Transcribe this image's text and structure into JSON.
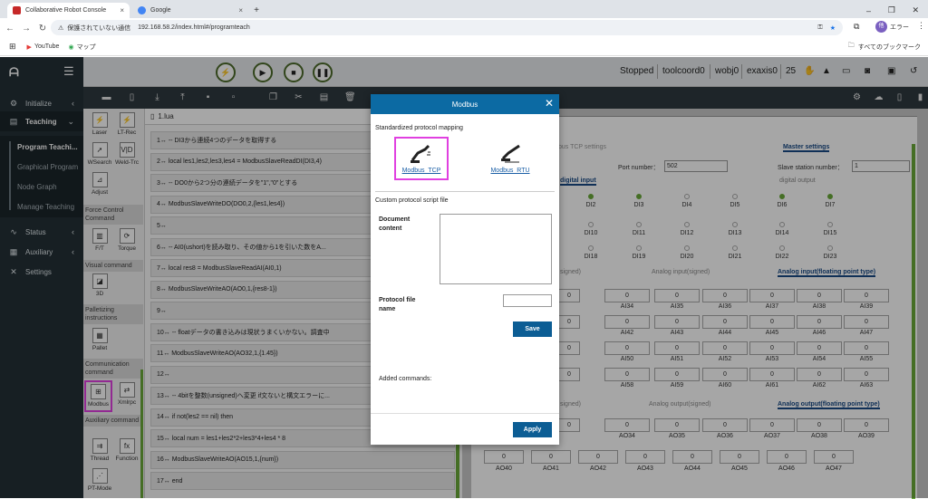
{
  "browser": {
    "tabs": [
      {
        "title": "Collaborative Robot Console",
        "favicon_color": "#c62828"
      },
      {
        "title": "Google",
        "favicon_color": "#4285f4"
      }
    ],
    "security": "保護されていない通信",
    "url": "192.168.58.2/index.html#/programteach",
    "bookmarks": [
      "YouTube",
      "マップ"
    ],
    "all_bookmarks": "すべてのブックマーク",
    "profile": "エラー"
  },
  "sidebar": {
    "items": [
      {
        "label": "Initialize",
        "icon": "gear-icon"
      },
      {
        "label": "Teaching",
        "icon": "monitor-icon"
      },
      {
        "label": "Status",
        "icon": "pulse-icon"
      },
      {
        "label": "Auxiliary",
        "icon": "grid-icon"
      },
      {
        "label": "Settings",
        "icon": "wrench-icon"
      }
    ],
    "subitems": [
      "Program Teachi...",
      "Graphical Program",
      "Node Graph",
      "Manage Teaching"
    ]
  },
  "topbar": {
    "status": "Stopped",
    "coord": "toolcoord0",
    "wobj": "wobj0",
    "exaxis": "exaxis0",
    "speed": "25"
  },
  "leftpanel": {
    "btns": [
      {
        "label": "Laser",
        "glyph": "⚡"
      },
      {
        "label": "LT-Rec",
        "glyph": "⚡"
      },
      {
        "label": "WSearch",
        "glyph": "➚"
      },
      {
        "label": "Weld-Trc",
        "glyph": "V|D"
      },
      {
        "label": "Adjust",
        "glyph": "⊿"
      },
      {
        "label": "F/T",
        "glyph": "▥"
      },
      {
        "label": "Torque",
        "glyph": "⟳"
      },
      {
        "label": "3D",
        "glyph": "◪"
      },
      {
        "label": "Pallet",
        "glyph": "▦"
      },
      {
        "label": "Modbus",
        "glyph": "⊞"
      },
      {
        "label": "Xmlrpc",
        "glyph": "⇄"
      },
      {
        "label": "Thread",
        "glyph": "⇉"
      },
      {
        "label": "Function",
        "glyph": "fx"
      },
      {
        "label": "PT-Mode",
        "glyph": "⋰"
      }
    ],
    "sections": [
      "Force Control Command",
      "Visual command",
      "Palletizing instructions",
      "Communication command",
      "Auxiliary command"
    ]
  },
  "code": {
    "file": "1.lua",
    "lines": [
      "1↔ -- DI3から連続4つのデータを取得する",
      "2↔ local les1,les2,les3,les4 = ModbusSlaveReadDI(DI3,4)",
      "3↔ -- DO0から2つ分の連続データを\"1\",\"0\"とする",
      "4↔ ModbusSlaveWriteDO(DO0,2,{les1,les4})",
      "5↔",
      "6↔ -- AI0(ushort)を読み取り、その値から1を引いた数をA...",
      "7↔ local res8 = ModbusSlaveReadAI(AI0,1)",
      "8↔ ModbusSlaveWriteAO(AO0,1,{res8-1})",
      "9↔",
      "10↔ -- floatデータの書き込みは現状うまくいかない。調査中",
      "11↔ ModbusSlaveWriteAO(AO32,1,{1.45})",
      "12↔",
      "13↔ -- 4bitを整数(unsigned)へ変更 if文ないと構文エラーに...",
      "14↔ if not(les2 == nil) then",
      "15↔ local num = les1+les2*2+les3*4+les4 * 8",
      "16↔ ModbusSlaveWriteAO(AO15,1,{num})",
      "17↔ end"
    ]
  },
  "right": {
    "tab_partial": "bus TCP settings",
    "tab_master": "Master settings",
    "port_label": "Port number：",
    "port_value": "502",
    "slave_label": "Slave station number：",
    "slave_value": "1",
    "di_title": "digital input",
    "do_title": "digital output",
    "di_row1": [
      "DI2",
      "DI3",
      "DI4",
      "DI5",
      "DI6",
      "DI7"
    ],
    "di_row1_on": [
      true,
      true,
      false,
      false,
      true,
      true
    ],
    "di_row2": [
      "DI10",
      "DI11",
      "DI12",
      "DI13",
      "DI14",
      "DI15"
    ],
    "di_row3": [
      "DI18",
      "DI19",
      "DI20",
      "DI21",
      "DI22",
      "DI23"
    ],
    "ai_tabs": [
      "signed)",
      "Analog input(signed)",
      "Analog input(floating point type)"
    ],
    "ai_rows": [
      [
        "AI34",
        "AI35",
        "AI36",
        "AI37",
        "AI38",
        "AI39"
      ],
      [
        "AI42",
        "AI43",
        "AI44",
        "AI45",
        "AI46",
        "AI47"
      ],
      [
        "AI50",
        "AI51",
        "AI52",
        "AI53",
        "AI54",
        "AI55"
      ],
      [
        "AI58",
        "AI59",
        "AI60",
        "AI61",
        "AI62",
        "AI63"
      ]
    ],
    "ao_tabs": [
      "signed)",
      "Analog output(signed)",
      "Analog output(floating point type)"
    ],
    "ao_row1": [
      "AO34",
      "AO35",
      "AO36",
      "AO37",
      "AO38",
      "AO39"
    ],
    "ao_row2": [
      "AO40",
      "AO41",
      "AO42",
      "AO43",
      "AO44",
      "AO45",
      "AO46",
      "AO47"
    ],
    "zero": "0"
  },
  "modal": {
    "title": "Modbus",
    "std_section": "Standardized protocol mapping",
    "tcp_label": "Modbus_TCP",
    "rtu_label": "Modbus_RTU",
    "custom_section": "Custom protocol script file",
    "doc_label": "Document content",
    "proto_label": "Protocol file name",
    "save": "Save",
    "added": "Added commands:",
    "apply": "Apply"
  },
  "colors": {
    "accent": "#0c6aa3",
    "highlight": "#e040e0",
    "sidebar": "#243036",
    "green": "#6aaa3a"
  }
}
